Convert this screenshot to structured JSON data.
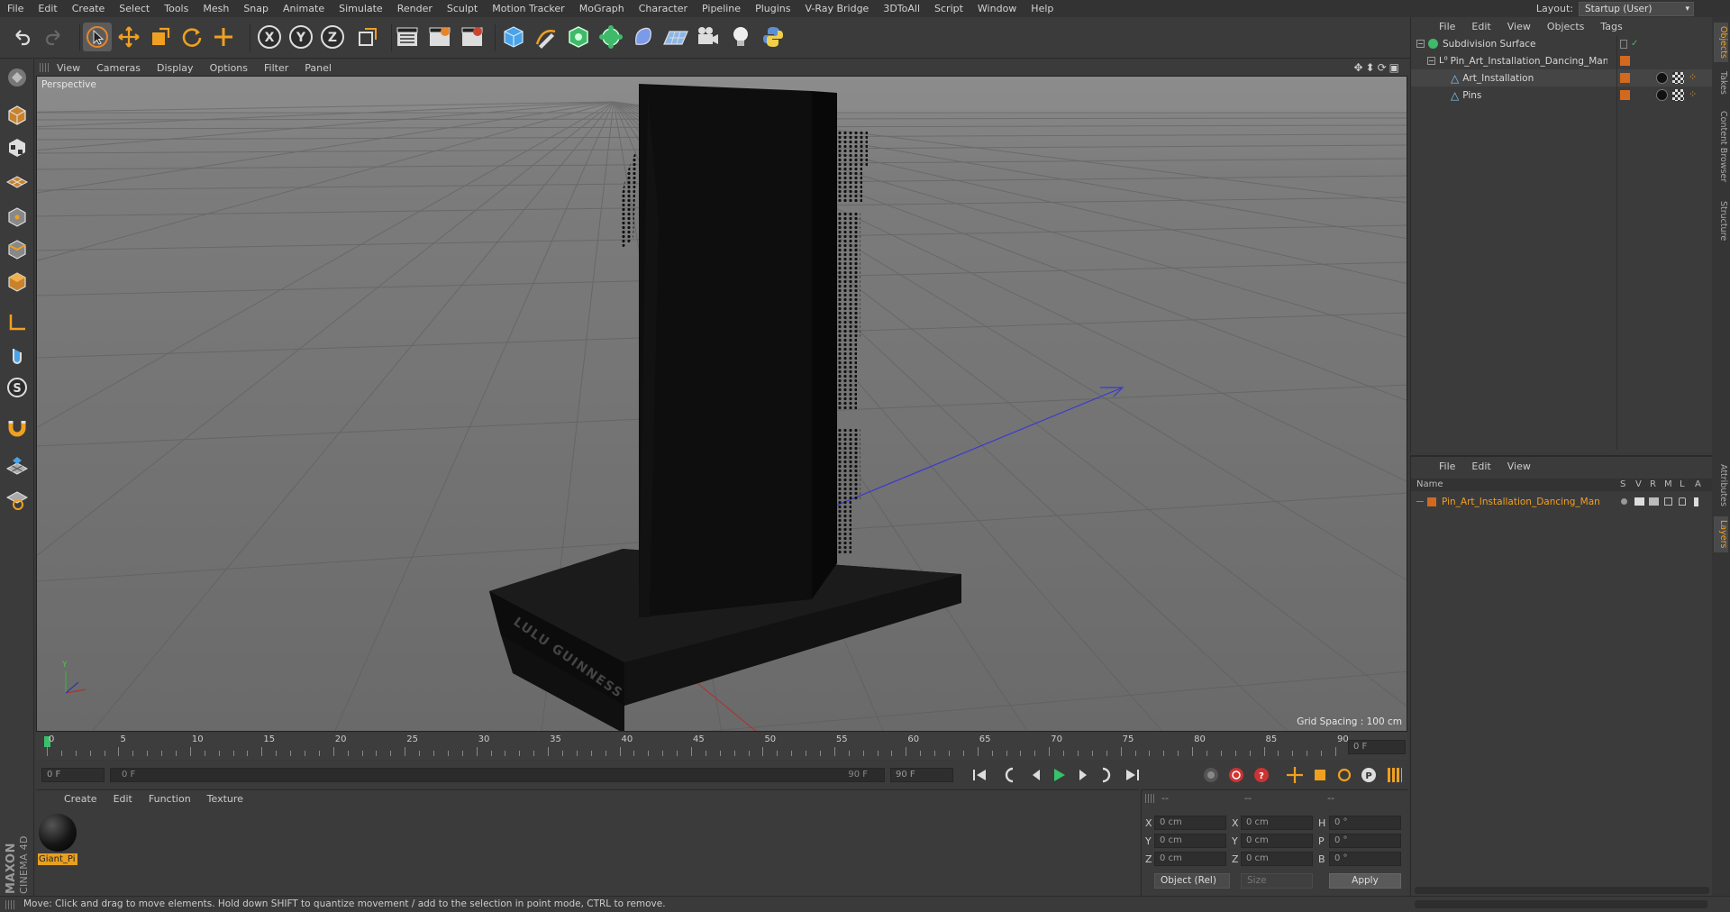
{
  "menubar": {
    "items": [
      "File",
      "Edit",
      "Create",
      "Select",
      "Tools",
      "Mesh",
      "Snap",
      "Animate",
      "Simulate",
      "Render",
      "Sculpt",
      "Motion Tracker",
      "MoGraph",
      "Character",
      "Pipeline",
      "Plugins",
      "V-Ray Bridge",
      "3DToAll",
      "Script",
      "Window",
      "Help"
    ],
    "layout_label": "Layout:",
    "layout_value": "Startup (User)"
  },
  "toolbar": {
    "icons": [
      "undo-icon",
      "redo-icon",
      "select-arrow-icon",
      "move-icon",
      "scale-icon",
      "rotate-icon",
      "last-tool-icon",
      "x-axis-icon",
      "y-axis-icon",
      "z-axis-icon",
      "world-coords-icon",
      "render-view-icon",
      "render-picture-viewer-icon",
      "edit-render-settings-icon",
      "cube-primitive-icon",
      "pen-spline-icon",
      "subdivision-nurbs-icon",
      "cloner-icon",
      "deformer-icon",
      "floor-icon",
      "camera-icon",
      "light-icon",
      "python-icon"
    ]
  },
  "viewport": {
    "menu": [
      "View",
      "Cameras",
      "Display",
      "Options",
      "Filter",
      "Panel"
    ],
    "label": "Perspective",
    "grid_spacing": "Grid Spacing : 100 cm",
    "logo_text": "LULU GUINNESS",
    "axis_y": "Y"
  },
  "timeline": {
    "ticks": [
      "0",
      "5",
      "10",
      "15",
      "20",
      "25",
      "30",
      "35",
      "40",
      "45",
      "50",
      "55",
      "60",
      "65",
      "70",
      "75",
      "80",
      "85",
      "90"
    ],
    "current_frame_field": "0 F"
  },
  "transport": {
    "start_field": "0 F",
    "range_start": "0 F",
    "range_end": "90 F",
    "end_field": "90 F"
  },
  "material_panel": {
    "menu": [
      "Create",
      "Edit",
      "Function",
      "Texture"
    ],
    "material_name": "Giant_Pi"
  },
  "coord_panel": {
    "header": [
      "--",
      "--",
      "--"
    ],
    "rows": [
      {
        "a_label": "X",
        "a_val": "0 cm",
        "b_label": "X",
        "b_val": "0 cm",
        "c_label": "H",
        "c_val": "0 °"
      },
      {
        "a_label": "Y",
        "a_val": "0 cm",
        "b_label": "Y",
        "b_val": "0 cm",
        "c_label": "P",
        "c_val": "0 °"
      },
      {
        "a_label": "Z",
        "a_val": "0 cm",
        "b_label": "Z",
        "b_val": "0 cm",
        "c_label": "B",
        "c_val": "0 °"
      }
    ],
    "mode_select": "Object (Rel)",
    "size_select": "Size",
    "apply_label": "Apply"
  },
  "object_panel": {
    "menu": [
      "File",
      "Edit",
      "View",
      "Objects",
      "Tags"
    ],
    "objects": [
      {
        "name": "Subdivision Surface",
        "indent": 0
      },
      {
        "name": "Pin_Art_Installation_Dancing_Man",
        "indent": 1
      },
      {
        "name": "Art_Installation",
        "indent": 2
      },
      {
        "name": "Pins",
        "indent": 2
      }
    ]
  },
  "layer_panel": {
    "menu": [
      "File",
      "Edit",
      "View"
    ],
    "col_name": "Name",
    "cols": [
      "S",
      "V",
      "R",
      "M",
      "L",
      "A"
    ],
    "layer_name": "Pin_Art_Installation_Dancing_Man"
  },
  "right_tabs": [
    "Objects",
    "Takes",
    "Content Browser",
    "Structure",
    "Attributes",
    "Layers"
  ],
  "branding": {
    "line1": "MAXON",
    "line2": "CINEMA 4D"
  },
  "status": "Move: Click and drag to move elements. Hold down SHIFT to quantize movement / add to the selection in point mode, CTRL to remove.",
  "colors": {
    "accent_orange": "#d2691e",
    "selection_gray": "#5b5b5b",
    "viewport_bg": "#6e6e6e",
    "timeline_green": "#38c06a"
  }
}
